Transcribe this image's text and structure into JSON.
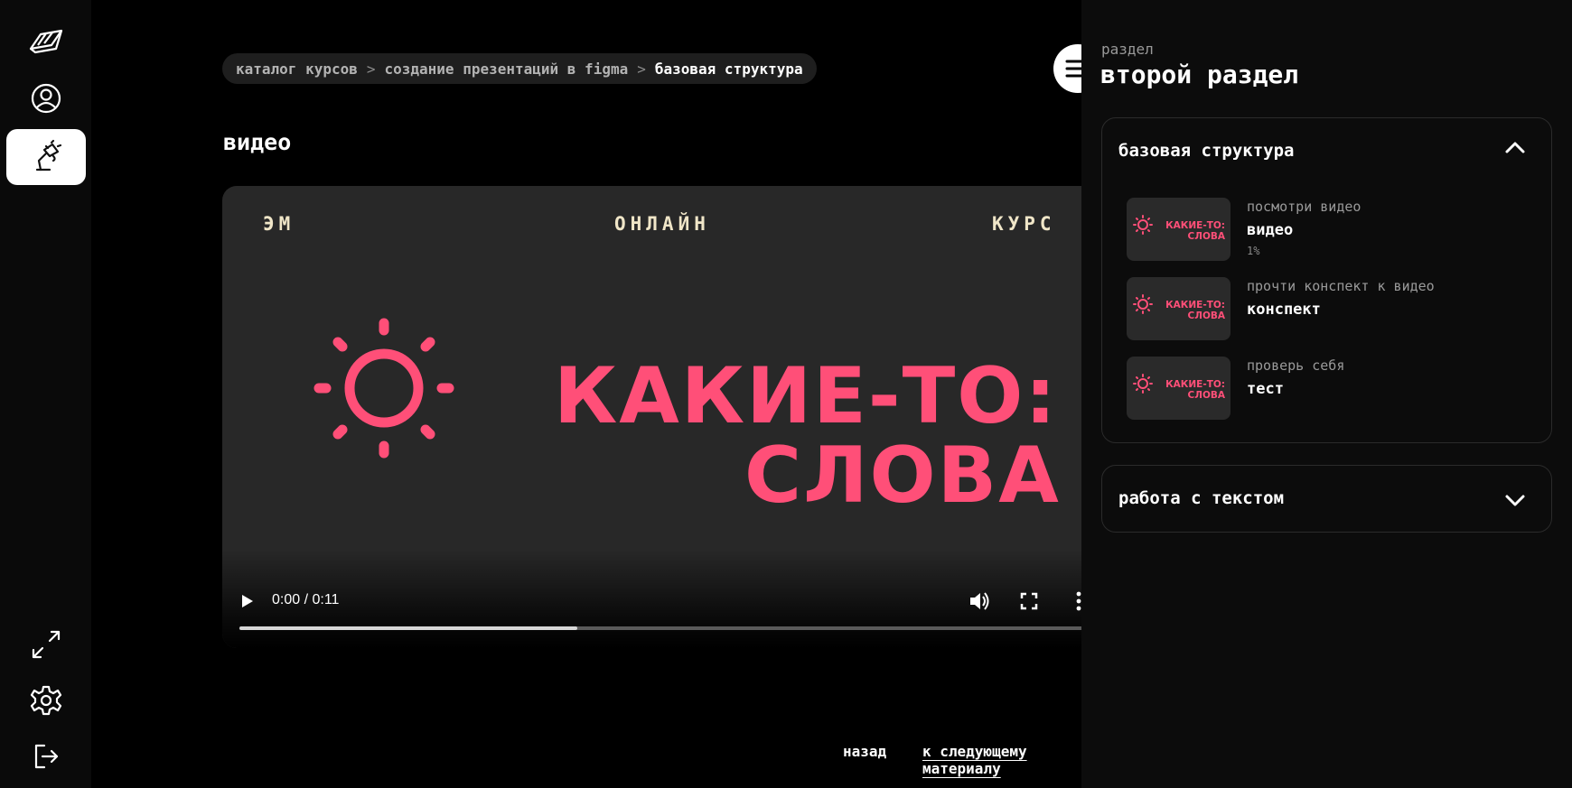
{
  "rail": {
    "items": [
      {
        "icon": "logo-icon"
      },
      {
        "icon": "profile-icon"
      },
      {
        "icon": "courses-lamp-icon"
      },
      {
        "icon": "expand-icon"
      },
      {
        "icon": "settings-gear-icon"
      },
      {
        "icon": "logout-icon"
      }
    ]
  },
  "breadcrumb": {
    "items": [
      "каталог курсов",
      "создание презентаций в figma",
      "базовая структура"
    ],
    "separator": ">"
  },
  "menu": {
    "icon": "hamburger-icon"
  },
  "content": {
    "title": "видео"
  },
  "video": {
    "poster": {
      "top_left": "ЭМ",
      "top_center": "ОНЛАЙН",
      "top_right": "КУРС",
      "line1": "КАКИЕ-ТО:",
      "line2": "СЛОВА"
    },
    "time": "0:00 / 0:11",
    "buffered": 0.4
  },
  "footer_nav": {
    "back": "назад",
    "next": "к следующему материалу"
  },
  "panel": {
    "subtitle": "раздел",
    "title": "второй раздел",
    "sections": [
      {
        "title": "базовая структура",
        "expanded": true,
        "lessons": [
          {
            "kind": "посмотри видео",
            "name": "видео",
            "progress": "1%",
            "thumb_line1": "КАКИЕ-ТО:",
            "thumb_line2": "СЛОВА"
          },
          {
            "kind": "прочти конспект к видео",
            "name": "конспект",
            "thumb_line1": "КАКИЕ-ТО:",
            "thumb_line2": "СЛОВА"
          },
          {
            "kind": "проверь себя",
            "name": "тест",
            "thumb_line1": "КАКИЕ-ТО:",
            "thumb_line2": "СЛОВА"
          }
        ]
      },
      {
        "title": "работа с текстом",
        "expanded": false
      }
    ]
  },
  "colors": {
    "accent": "#ff4f78",
    "poster_text": "#f0e6c8",
    "background": "#000000",
    "panel": "#0c0c0c"
  }
}
